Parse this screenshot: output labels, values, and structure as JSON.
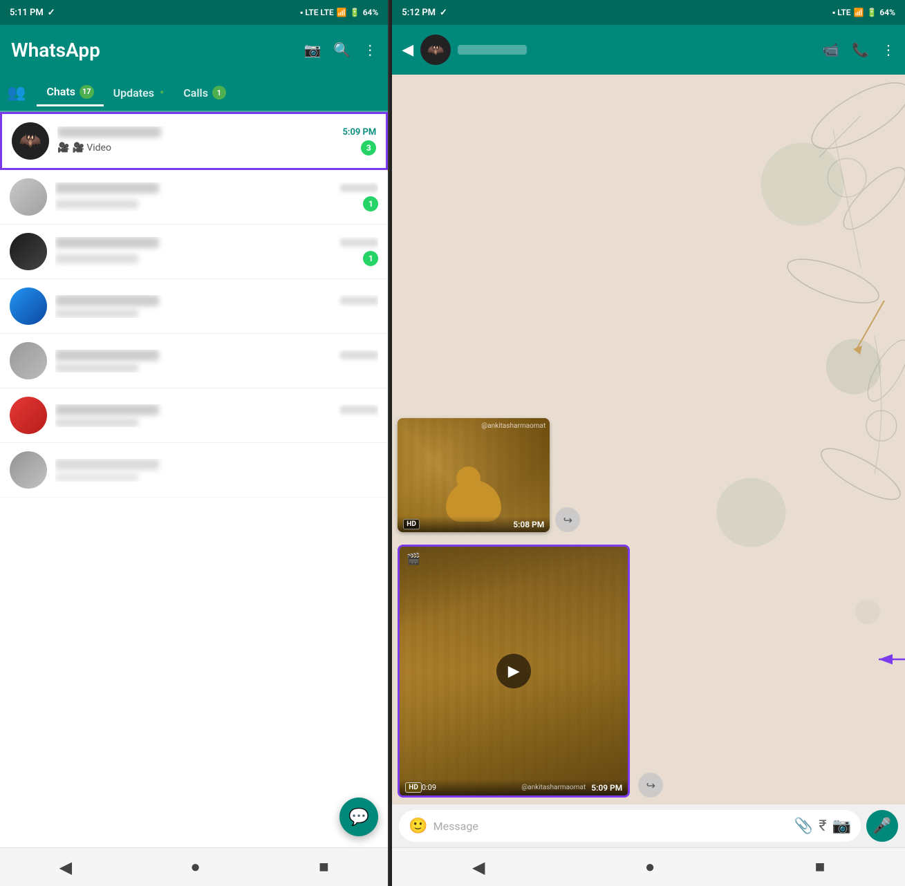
{
  "left_phone": {
    "status_bar": {
      "time": "5:11 PM",
      "battery": "64%"
    },
    "header": {
      "title": "WhatsApp",
      "icons": [
        "camera",
        "search",
        "more"
      ]
    },
    "tabs": {
      "community_icon": "👥",
      "items": [
        {
          "label": "Chats",
          "badge": "17",
          "active": true
        },
        {
          "label": "Updates",
          "dot": true
        },
        {
          "label": "Calls",
          "badge": "1"
        }
      ]
    },
    "chats": [
      {
        "id": "chat-1",
        "time": "5:09 PM",
        "preview": "🎥 Video",
        "unread": "3",
        "highlighted": true
      },
      {
        "id": "chat-2",
        "unread": "1"
      },
      {
        "id": "chat-3",
        "unread": "1"
      },
      {
        "id": "chat-4"
      },
      {
        "id": "chat-5"
      },
      {
        "id": "chat-6"
      }
    ],
    "nav": {
      "back": "◀",
      "home": "●",
      "recent": "■"
    }
  },
  "right_phone": {
    "status_bar": {
      "time": "5:12 PM",
      "battery": "64%"
    },
    "header": {
      "icons": [
        "video-camera",
        "phone",
        "more"
      ]
    },
    "messages": [
      {
        "type": "video",
        "hd": true,
        "timestamp": "5:08 PM",
        "watermark": "@ankitasharmaomat"
      },
      {
        "type": "video",
        "hd": true,
        "duration": "0:09",
        "timestamp": "5:09 PM",
        "watermark": "@ankitasharmaomat",
        "highlighted": true
      }
    ],
    "input": {
      "placeholder": "Message",
      "icons": [
        "emoji",
        "attach",
        "rupee",
        "camera"
      ]
    },
    "nav": {
      "back": "◀",
      "home": "●",
      "recent": "■"
    }
  }
}
